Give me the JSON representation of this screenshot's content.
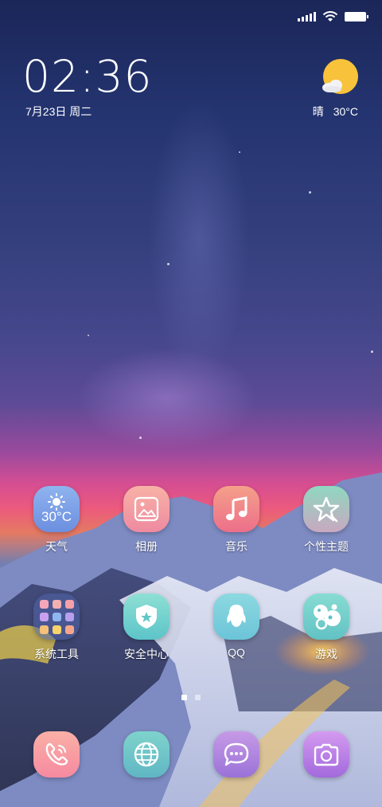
{
  "status_bar": {
    "icons": [
      "signal-icon",
      "wifi-icon",
      "battery-icon"
    ]
  },
  "clock": {
    "time": "02:36",
    "date": "7月23日 周二"
  },
  "weather": {
    "condition": "晴",
    "temperature": "30°C",
    "icon": "sun-cloud-icon"
  },
  "apps": [
    {
      "label": "天气",
      "icon": "weather-icon",
      "badge_text": "30°C"
    },
    {
      "label": "相册",
      "icon": "gallery-icon"
    },
    {
      "label": "音乐",
      "icon": "music-note-icon"
    },
    {
      "label": "个性主题",
      "icon": "star-icon"
    },
    {
      "label": "系统工具",
      "icon": "folder-icon"
    },
    {
      "label": "安全中心",
      "icon": "shield-icon"
    },
    {
      "label": "QQ",
      "icon": "qq-penguin-icon"
    },
    {
      "label": "游戏",
      "icon": "game-icon"
    }
  ],
  "page_indicator": {
    "total_pages": 2,
    "current_page": 1
  },
  "dock": [
    {
      "name": "Phone",
      "icon": "phone-icon"
    },
    {
      "name": "Browser",
      "icon": "globe-icon"
    },
    {
      "name": "Messages",
      "icon": "message-icon"
    },
    {
      "name": "Camera",
      "icon": "camera-icon"
    }
  ],
  "colors": {
    "sun": "#F8C33A",
    "weather_app": "#7CA2E8",
    "teal_app": "#6CC8C8",
    "pink_app": "#F59AA0",
    "purple_app": "#A878DE"
  }
}
